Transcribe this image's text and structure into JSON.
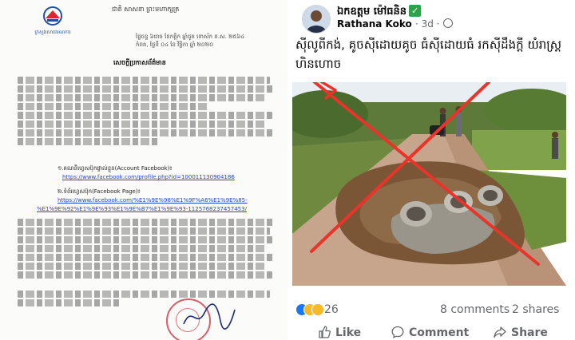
{
  "document": {
    "logo_caption": "ក្រសួងសាធារណការ",
    "motto": "ជាតិ សាសនា ព្រះមហាក្សត្រ",
    "date_line_1": "ថ្ងៃចន្ទ ៦រោច ខែកត្តិក ឆ្នាំជូត ទោស័ក ព.ស. ២៥៦៤",
    "date_line_2": "កំពត, ថ្ងៃទី ០៤ ខែ វិច្ឆិកា ឆ្នាំ ២០២០",
    "heading": "សេចក្តីប្រកាសព័ត៌មាន",
    "items": [
      {
        "label": "១.គណនីហ្វេសប៊ុកផ្ទាល់ខ្លួន(Account Facebook)៖",
        "links": [
          "https://www.facebook.com/profile.php?id=100011130904186"
        ]
      },
      {
        "label": "២.ទំព័រហ្វេសប៊ុក(Facebook Page)៖",
        "links": [
          "https://www.facebook.com/%E1%9E%98%E1%9F%A6%E1%9E%85-",
          "%E1%9E%92%E1%9E%93%E1%9E%B7%E1%9E%93-1125768237457453/"
        ]
      }
    ]
  },
  "post": {
    "author": "ឯកឧត្តម ម៉ៅធនិន",
    "posted_by": "Rathana Koko",
    "time": "· 3d ·",
    "text": "ស៊ីលូពីកង់, គូចស៊ីដោយគូច ធំស៊ីដោយធំ រកស៊ីដឹងក្ដី យំរាស្រ្តហិនហោច",
    "reaction_count": "26",
    "comments": "8 comments",
    "shares": "2 shares",
    "actions": {
      "like": "Like",
      "comment": "Comment",
      "share": "Share"
    }
  },
  "colors": {
    "facebook_blue": "#1877f2",
    "cross_red": "#e8342a",
    "verified_green": "#31a24c"
  },
  "icons": [
    "verified-icon",
    "globe-icon",
    "like-reaction-icon",
    "haha-reaction-icon",
    "sad-reaction-icon",
    "thumbs-up-icon",
    "comment-bubble-icon",
    "share-arrow-icon"
  ]
}
